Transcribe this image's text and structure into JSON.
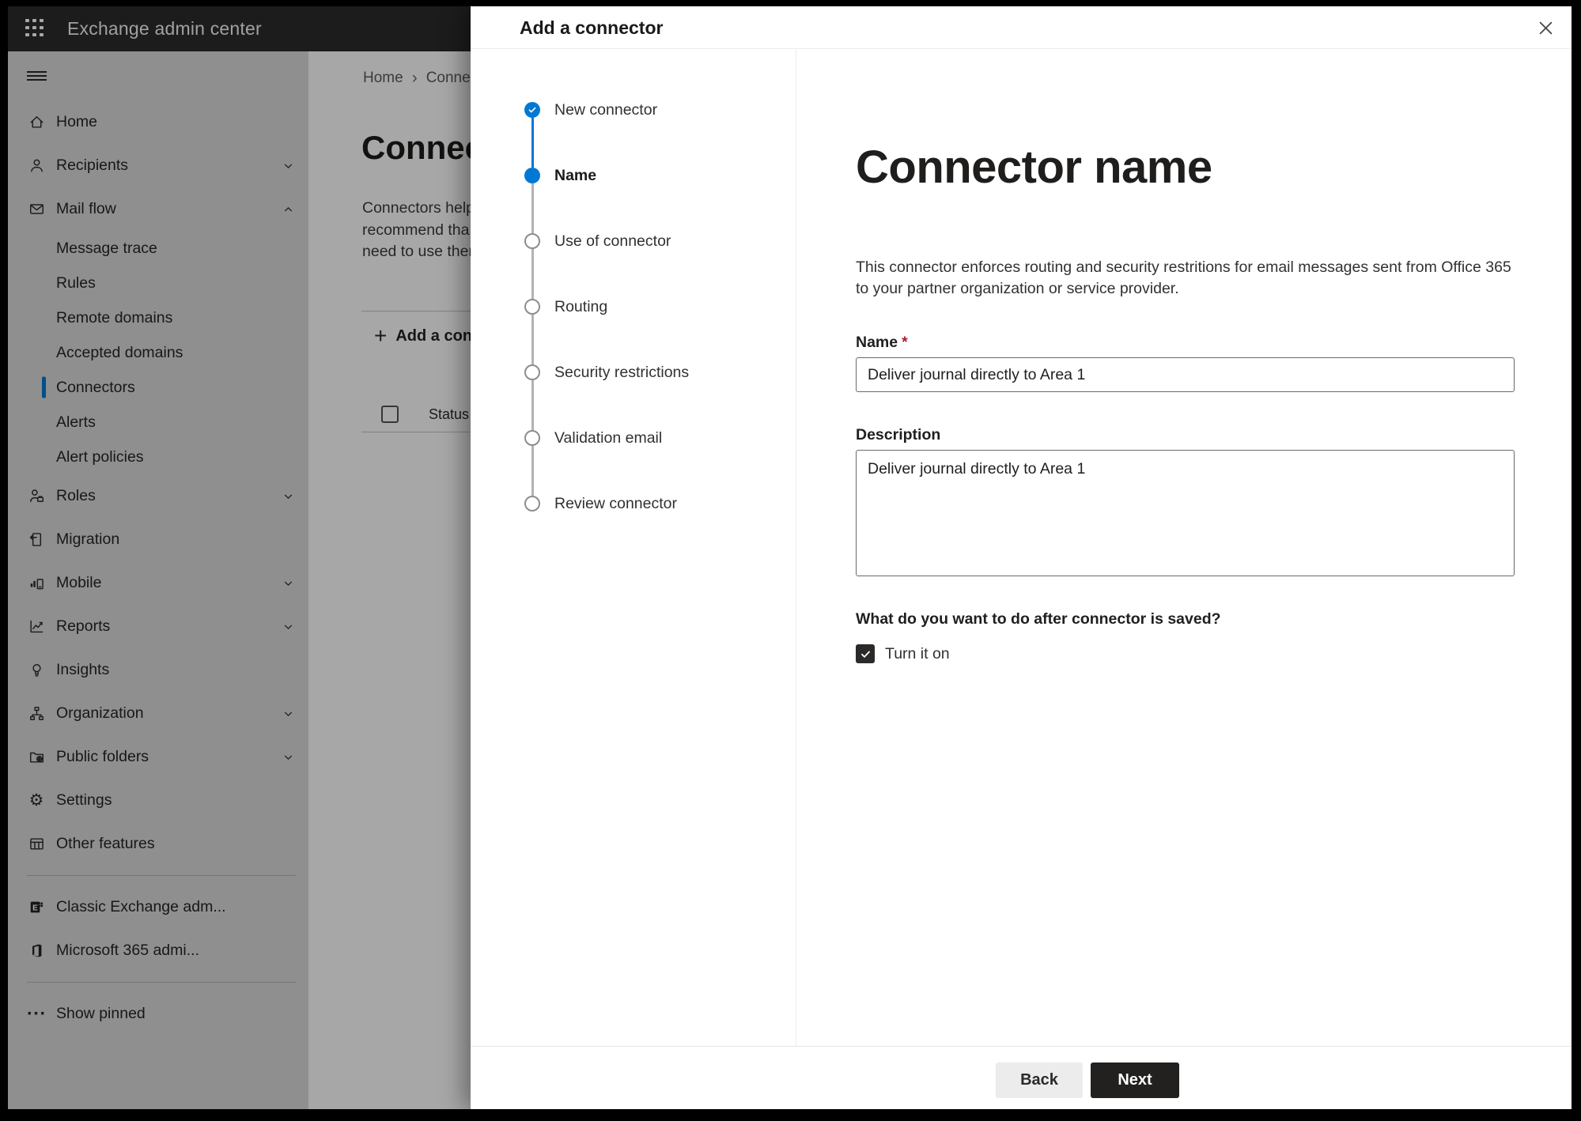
{
  "header": {
    "app_title": "Exchange admin center"
  },
  "sidebar": {
    "items": [
      {
        "label": "Home",
        "icon": "home-icon"
      },
      {
        "label": "Recipients",
        "icon": "person-icon",
        "chevron": "down"
      },
      {
        "label": "Mail flow",
        "icon": "mail-icon",
        "chevron": "up"
      },
      {
        "label": "Message trace",
        "sub": true
      },
      {
        "label": "Rules",
        "sub": true
      },
      {
        "label": "Remote domains",
        "sub": true
      },
      {
        "label": "Accepted domains",
        "sub": true
      },
      {
        "label": "Connectors",
        "sub": true,
        "selected": true
      },
      {
        "label": "Alerts",
        "sub": true
      },
      {
        "label": "Alert policies",
        "sub": true
      },
      {
        "label": "Roles",
        "icon": "roles-icon",
        "chevron": "down"
      },
      {
        "label": "Migration",
        "icon": "migration-icon"
      },
      {
        "label": "Mobile",
        "icon": "mobile-icon",
        "chevron": "down"
      },
      {
        "label": "Reports",
        "icon": "reports-icon",
        "chevron": "down"
      },
      {
        "label": "Insights",
        "icon": "insights-icon"
      },
      {
        "label": "Organization",
        "icon": "organization-icon",
        "chevron": "down"
      },
      {
        "label": "Public folders",
        "icon": "public-folders-icon",
        "chevron": "down"
      },
      {
        "label": "Settings",
        "icon": "settings-icon"
      },
      {
        "label": "Other features",
        "icon": "other-features-icon"
      }
    ],
    "footer_items": [
      {
        "label": "Classic Exchange adm...",
        "icon": "classic-exchange-icon"
      },
      {
        "label": "Microsoft 365 admi...",
        "icon": "microsoft-365-icon"
      }
    ],
    "show_pinned": {
      "label": "Show pinned",
      "icon": "ellipsis-icon"
    }
  },
  "page": {
    "breadcrumb": {
      "home": "Home",
      "separator": "›",
      "current": "Conne"
    },
    "title": "Connec",
    "intro_lines": [
      "Connectors help",
      "recommend tha",
      "need to use ther"
    ],
    "add_button": {
      "plus": "+",
      "label": "Add a conn"
    },
    "status_header": "Status"
  },
  "dialog": {
    "title": "Add a connector",
    "steps": [
      {
        "label": "New connector",
        "state": "done"
      },
      {
        "label": "Name",
        "state": "current"
      },
      {
        "label": "Use of connector",
        "state": "todo"
      },
      {
        "label": "Routing",
        "state": "todo"
      },
      {
        "label": "Security restrictions",
        "state": "todo"
      },
      {
        "label": "Validation email",
        "state": "todo"
      },
      {
        "label": "Review connector",
        "state": "todo"
      }
    ],
    "heading": "Connector name",
    "description_lines": [
      "This connector enforces routing and security restritions for email messages sent from Office 365",
      "to your partner organization or service provider."
    ],
    "name_field": {
      "label": "Name",
      "required_mark": "*",
      "value": "Deliver journal directly to Area 1"
    },
    "description_field": {
      "label": "Description",
      "value": "Deliver journal directly to Area 1"
    },
    "after_save": {
      "question": "What do you want to do after connector is saved?",
      "checkbox_label": "Turn it on",
      "checked": true
    },
    "footer": {
      "back": "Back",
      "next": "Next"
    }
  },
  "colors": {
    "accent": "#0078d4",
    "required": "#a4262c"
  }
}
